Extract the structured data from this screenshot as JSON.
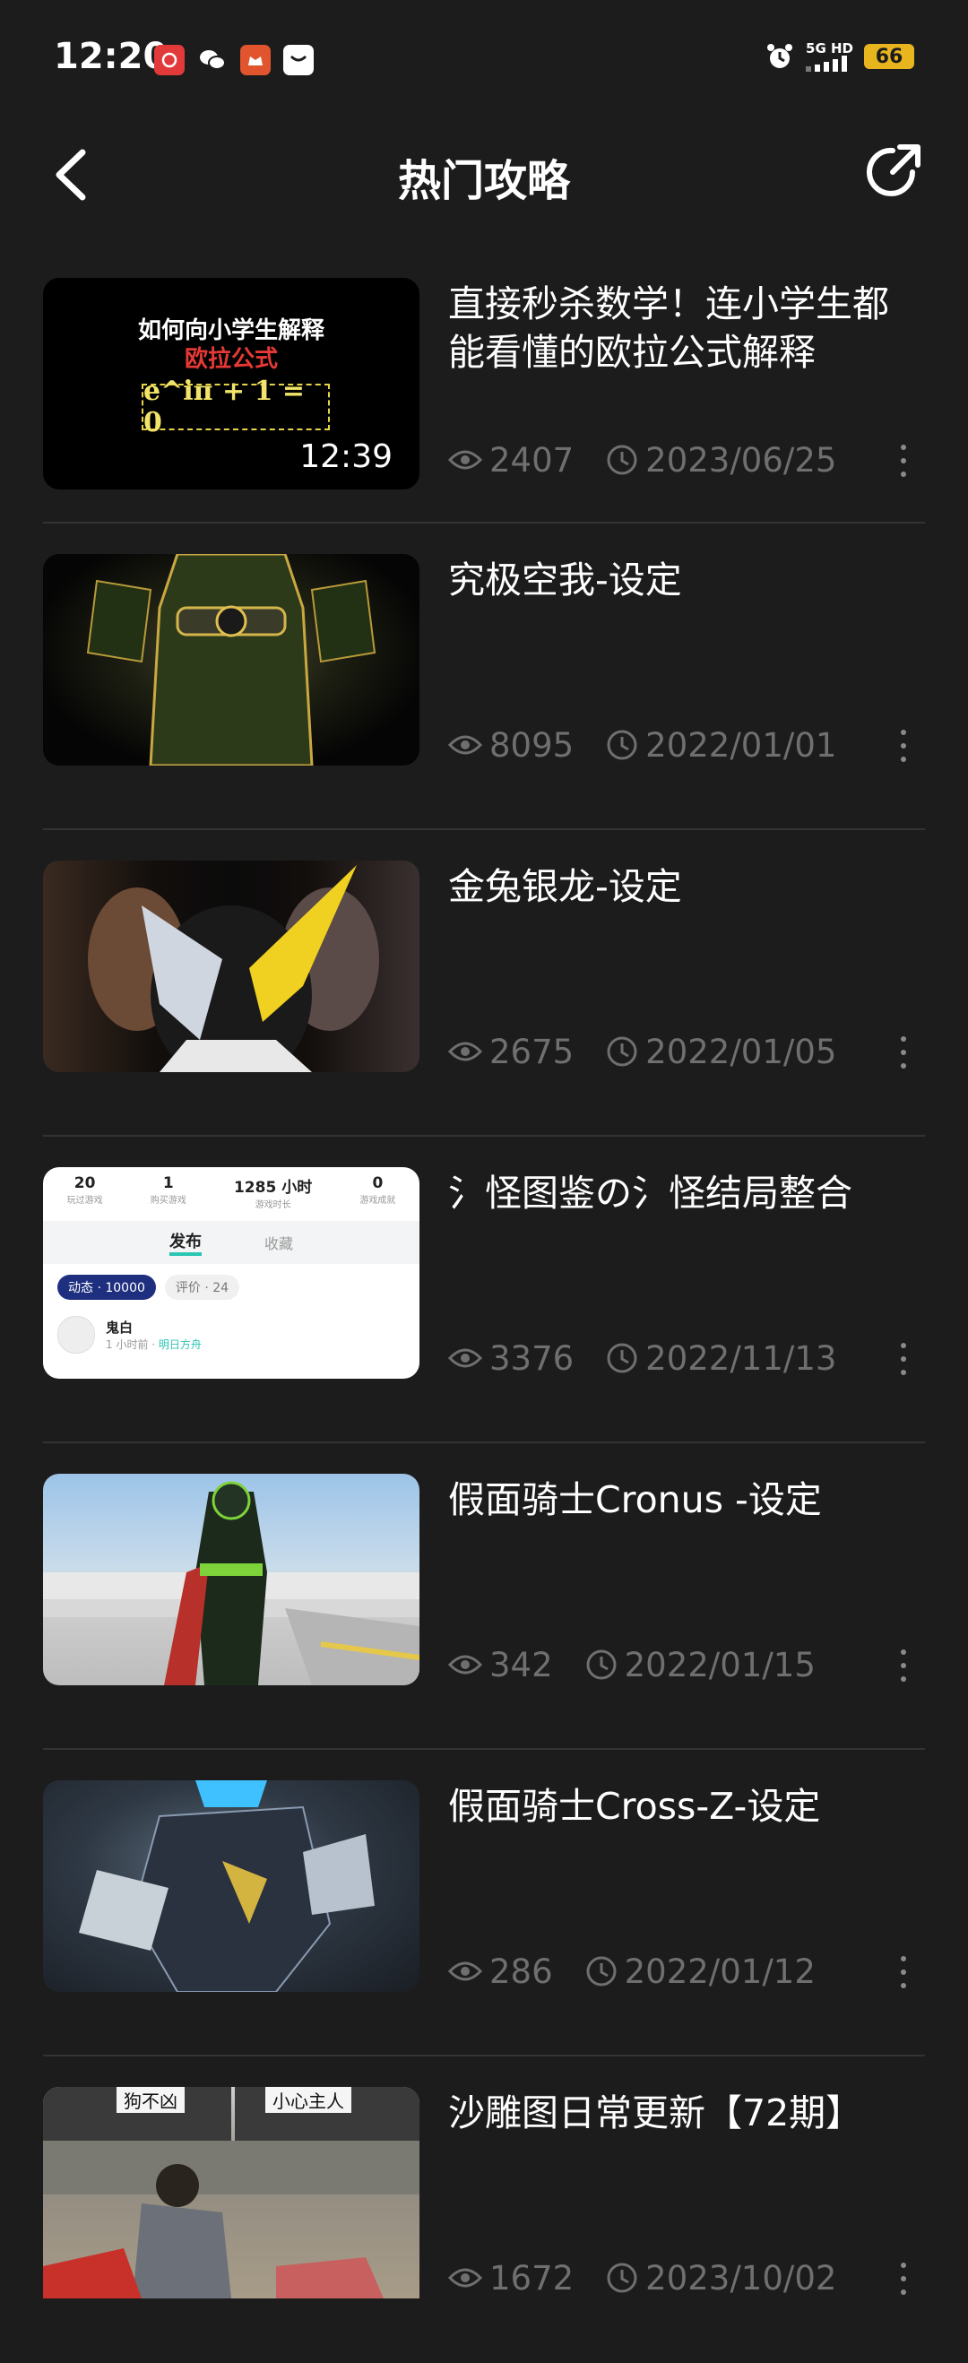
{
  "status_bar": {
    "time": "12:20",
    "network": "5G HD",
    "battery": "66",
    "notif_icons": [
      "netease-music-icon",
      "wechat-icon",
      "game-app-icon",
      "message-app-icon"
    ]
  },
  "header": {
    "title": "热门攻略",
    "back_icon": "chevron-left-icon",
    "share_icon": "share-icon"
  },
  "thumb1": {
    "line1": "如何向小学生解释",
    "line2": "欧拉公式",
    "formula": "e^iπ + 1 = 0",
    "duration": "12:39"
  },
  "thumb4": {
    "stats": [
      {
        "value": "20",
        "label": "玩过游戏"
      },
      {
        "value": "1",
        "label": "购买游戏"
      },
      {
        "value": "1285 小时",
        "label": "游戏时长"
      },
      {
        "value": "0",
        "label": "游戏成就"
      }
    ],
    "tab_active": "发布",
    "tab_other": "收藏",
    "chip1": "动态 · 10000",
    "chip2": "评价 · 24",
    "user": "鬼白",
    "time": "1 小时前 · ",
    "source": "明日方舟"
  },
  "articles": [
    {
      "title": "直接秒杀数学！连小学生都能看懂的欧拉公式解释",
      "views": "2407",
      "date": "2023/06/25"
    },
    {
      "title": "究极空我-设定",
      "views": "8095",
      "date": "2022/01/01"
    },
    {
      "title": "金兔银龙-设定",
      "views": "2675",
      "date": "2022/01/05"
    },
    {
      "title": "氵怪图鉴の氵怪结局整合",
      "views": "3376",
      "date": "2022/11/13"
    },
    {
      "title": "假面骑士Cronus -设定",
      "views": "342",
      "date": "2022/01/15"
    },
    {
      "title": "假面骑士Cross-Z-设定",
      "views": "286",
      "date": "2022/01/12"
    },
    {
      "title": "沙雕图日常更新【72期】",
      "views": "1672",
      "date": "2023/10/02"
    }
  ],
  "thumb7": {
    "sign1": "狗不凶",
    "sign2": "小心主人"
  },
  "colors": {
    "background": "#1c1c1c",
    "divider": "#333333",
    "meta_text": "#6f6f6f",
    "battery": "#e8b51e"
  }
}
